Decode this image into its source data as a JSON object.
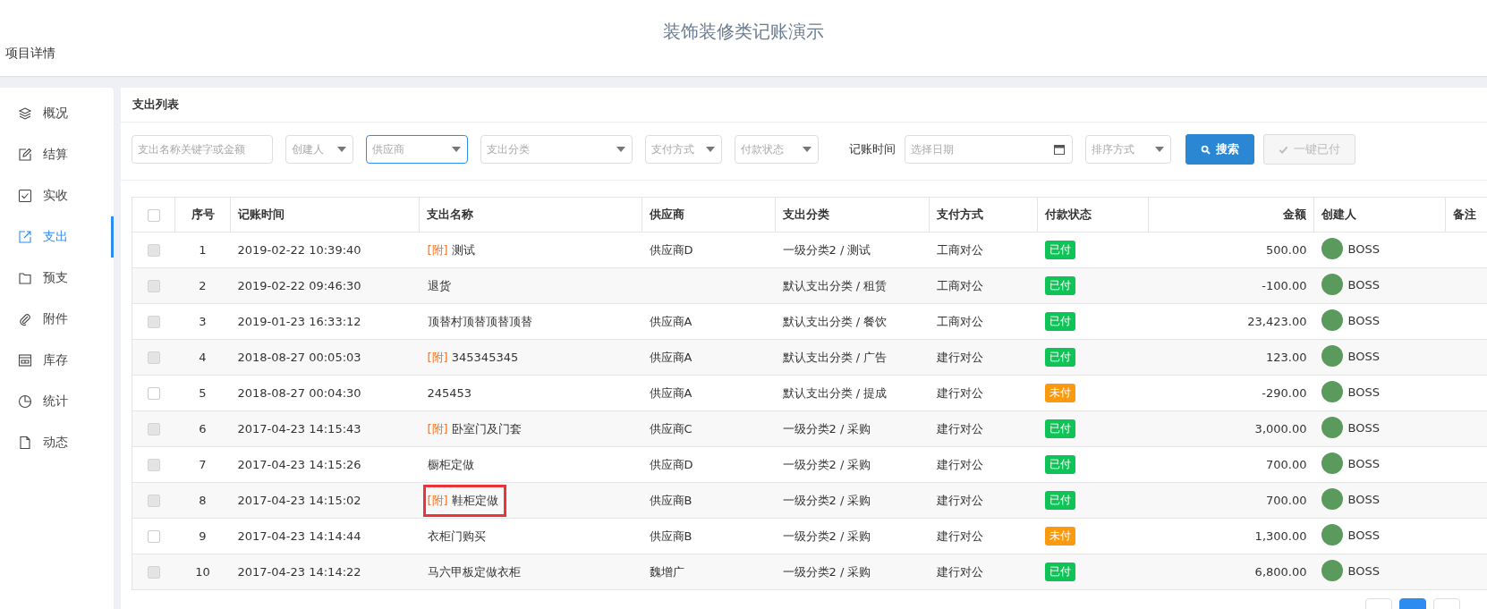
{
  "header": {
    "title": "装饰装修类记账演示",
    "project": "项目详情"
  },
  "sidebar": {
    "items": [
      {
        "label": "概况",
        "selected": false
      },
      {
        "label": "结算",
        "selected": false
      },
      {
        "label": "实收",
        "selected": false
      },
      {
        "label": "支出",
        "selected": true
      },
      {
        "label": "预支",
        "selected": false
      },
      {
        "label": "附件",
        "selected": false
      },
      {
        "label": "库存",
        "selected": false
      },
      {
        "label": "统计",
        "selected": false
      },
      {
        "label": "动态",
        "selected": false
      }
    ]
  },
  "panel_title": "支出列表",
  "filters": [
    {
      "kind": "text",
      "placeholder": "支出名称关键字或金额",
      "focused": false
    },
    {
      "kind": "select",
      "placeholder": "创建人",
      "focused": false
    },
    {
      "kind": "select",
      "placeholder": "供应商",
      "focused": true
    },
    {
      "kind": "select",
      "placeholder": "支出分类",
      "focused": false
    },
    {
      "kind": "select",
      "placeholder": "支付方式",
      "focused": false
    },
    {
      "kind": "select",
      "placeholder": "付款状态",
      "focused": false
    },
    {
      "kind": "label",
      "text": "记账时间"
    },
    {
      "kind": "date",
      "placeholder": "选择日期",
      "focused": false
    },
    {
      "kind": "select",
      "placeholder": "排序方式",
      "focused": false
    }
  ],
  "buttons": [
    {
      "label": "搜索",
      "kind": "search",
      "disabled": false
    },
    {
      "label": "一键已付",
      "kind": "check",
      "disabled": true
    }
  ],
  "table": {
    "header_checked": false,
    "columns": [
      "序号",
      "记账时间",
      "支出名称",
      "供应商",
      "支出分类",
      "支付方式",
      "付款状态",
      "金额",
      "创建人",
      "备注"
    ],
    "rows": [
      {
        "no": "1",
        "time": "2019-02-22 10:39:40",
        "tag": "[附]",
        "name": "测试",
        "supplier": "供应商D",
        "category": "一级分类2 / 测试",
        "payment": "工商对公",
        "status": "已付",
        "paid": true,
        "amount": "500.00",
        "creator": "BOSS",
        "disabled": true
      },
      {
        "no": "2",
        "time": "2019-02-22 09:46:30",
        "name": "退货",
        "category": "默认支出分类 / 租赁",
        "payment": "工商对公",
        "status": "已付",
        "paid": true,
        "amount": "-100.00",
        "creator": "BOSS",
        "disabled": true
      },
      {
        "no": "3",
        "time": "2019-01-23 16:33:12",
        "name": "顶替村顶替顶替顶替",
        "supplier": "供应商A",
        "category": "默认支出分类 / 餐饮",
        "payment": "工商对公",
        "status": "已付",
        "paid": true,
        "amount": "23,423.00",
        "creator": "BOSS",
        "disabled": true
      },
      {
        "no": "4",
        "time": "2018-08-27 00:05:03",
        "tag": "[附]",
        "name": "345345345",
        "supplier": "供应商A",
        "category": "默认支出分类 / 广告",
        "payment": "建行对公",
        "status": "已付",
        "paid": true,
        "amount": "123.00",
        "creator": "BOSS",
        "disabled": true
      },
      {
        "no": "5",
        "time": "2018-08-27 00:04:30",
        "name": "245453",
        "supplier": "供应商A",
        "category": "默认支出分类 / 提成",
        "payment": "建行对公",
        "status": "未付",
        "paid": false,
        "amount": "-290.00",
        "creator": "BOSS",
        "disabled": false
      },
      {
        "no": "6",
        "time": "2017-04-23 14:15:43",
        "tag": "[附]",
        "name": "卧室门及门套",
        "supplier": "供应商C",
        "category": "一级分类2 / 采购",
        "payment": "建行对公",
        "status": "已付",
        "paid": true,
        "amount": "3,000.00",
        "creator": "BOSS",
        "disabled": true
      },
      {
        "no": "7",
        "time": "2017-04-23 14:15:26",
        "name": "橱柜定做",
        "supplier": "供应商D",
        "category": "一级分类2 / 采购",
        "payment": "建行对公",
        "status": "已付",
        "paid": true,
        "amount": "700.00",
        "creator": "BOSS",
        "disabled": true
      },
      {
        "no": "8",
        "time": "2017-04-23 14:15:02",
        "tag": "[附]",
        "name": "鞋柜定做",
        "highlighted": true,
        "supplier": "供应商B",
        "category": "一级分类2 / 采购",
        "payment": "建行对公",
        "status": "已付",
        "paid": true,
        "amount": "700.00",
        "creator": "BOSS",
        "disabled": true
      },
      {
        "no": "9",
        "time": "2017-04-23 14:14:44",
        "name": "衣柜门购买",
        "supplier": "供应商B",
        "category": "一级分类2 / 采购",
        "payment": "建行对公",
        "status": "未付",
        "paid": false,
        "amount": "1,300.00",
        "creator": "BOSS",
        "disabled": false
      },
      {
        "no": "10",
        "time": "2017-04-23 14:14:22",
        "name": "马六甲板定做衣柜",
        "supplier": "魏增广",
        "category": "一级分类2 / 采购",
        "payment": "建行对公",
        "status": "已付",
        "paid": true,
        "amount": "6,800.00",
        "creator": "BOSS",
        "disabled": true
      }
    ]
  },
  "pager": [
    {
      "selected": false
    },
    {
      "selected": true
    },
    {
      "selected": false
    }
  ]
}
